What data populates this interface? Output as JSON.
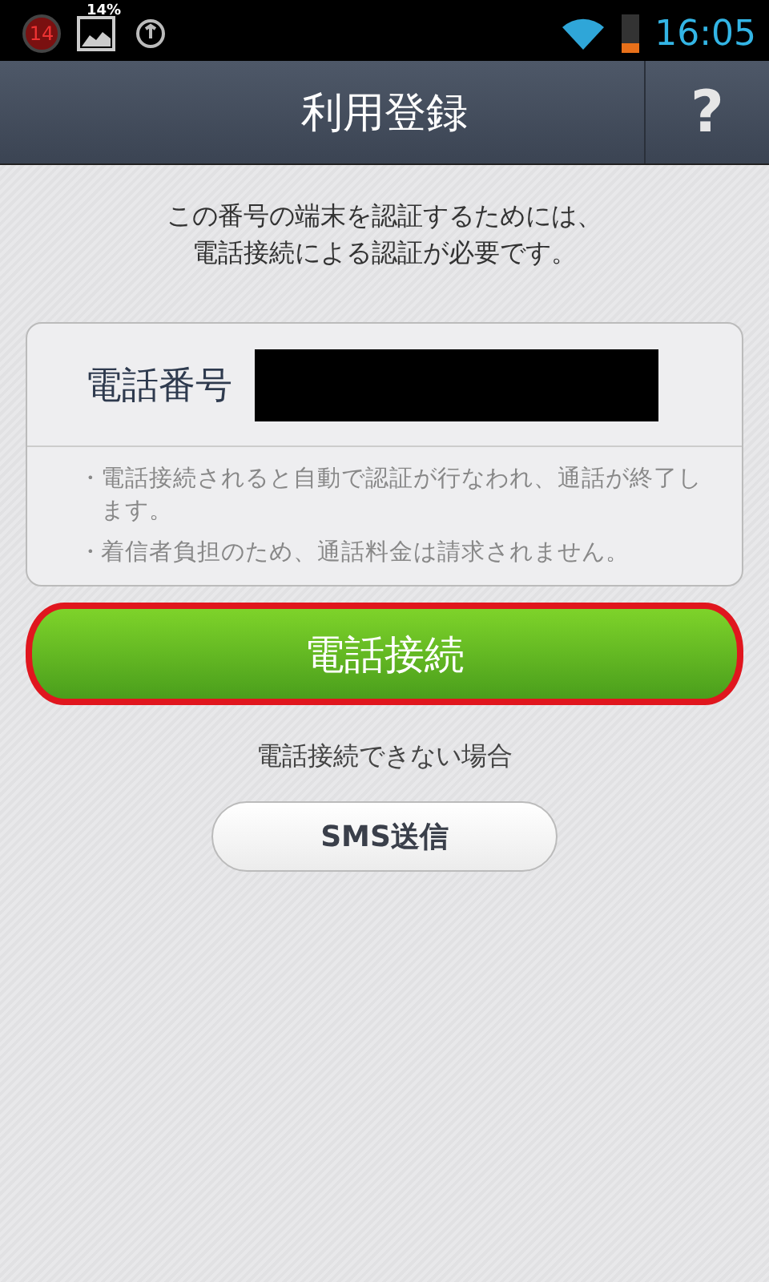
{
  "status_bar": {
    "badge": "14",
    "image_percent": "14%",
    "time": "16:05"
  },
  "header": {
    "title": "利用登録",
    "help": "?"
  },
  "intro": [
    "この番号の端末を認証するためには、",
    "電話接続による認証が必要です。"
  ],
  "phone_card": {
    "label": "電話番号",
    "notes": [
      {
        "bullet": "・",
        "text": "電話接続されると自動で認証が行なわれ、通話が終了します。"
      },
      {
        "bullet": "・",
        "text": "着信者負担のため、通話料金は請求されません。"
      }
    ]
  },
  "call_button": {
    "label": "電話接続",
    "highlighted": true
  },
  "fallback_text": "電話接続できない場合",
  "sms_button": {
    "label": "SMS送信"
  }
}
